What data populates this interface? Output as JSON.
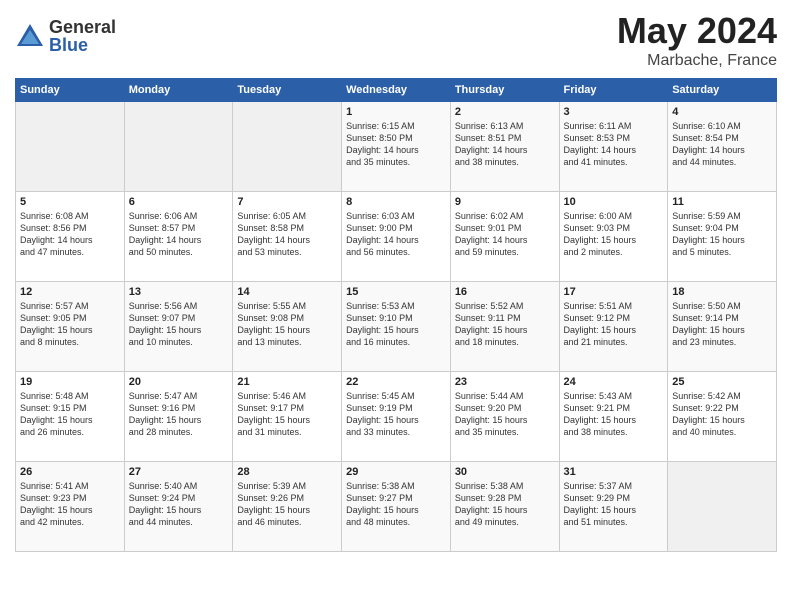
{
  "header": {
    "logo_general": "General",
    "logo_blue": "Blue",
    "month_title": "May 2024",
    "location": "Marbache, France"
  },
  "calendar": {
    "days_of_week": [
      "Sunday",
      "Monday",
      "Tuesday",
      "Wednesday",
      "Thursday",
      "Friday",
      "Saturday"
    ],
    "weeks": [
      [
        {
          "day": "",
          "content": ""
        },
        {
          "day": "",
          "content": ""
        },
        {
          "day": "",
          "content": ""
        },
        {
          "day": "1",
          "content": "Sunrise: 6:15 AM\nSunset: 8:50 PM\nDaylight: 14 hours\nand 35 minutes."
        },
        {
          "day": "2",
          "content": "Sunrise: 6:13 AM\nSunset: 8:51 PM\nDaylight: 14 hours\nand 38 minutes."
        },
        {
          "day": "3",
          "content": "Sunrise: 6:11 AM\nSunset: 8:53 PM\nDaylight: 14 hours\nand 41 minutes."
        },
        {
          "day": "4",
          "content": "Sunrise: 6:10 AM\nSunset: 8:54 PM\nDaylight: 14 hours\nand 44 minutes."
        }
      ],
      [
        {
          "day": "5",
          "content": "Sunrise: 6:08 AM\nSunset: 8:56 PM\nDaylight: 14 hours\nand 47 minutes."
        },
        {
          "day": "6",
          "content": "Sunrise: 6:06 AM\nSunset: 8:57 PM\nDaylight: 14 hours\nand 50 minutes."
        },
        {
          "day": "7",
          "content": "Sunrise: 6:05 AM\nSunset: 8:58 PM\nDaylight: 14 hours\nand 53 minutes."
        },
        {
          "day": "8",
          "content": "Sunrise: 6:03 AM\nSunset: 9:00 PM\nDaylight: 14 hours\nand 56 minutes."
        },
        {
          "day": "9",
          "content": "Sunrise: 6:02 AM\nSunset: 9:01 PM\nDaylight: 14 hours\nand 59 minutes."
        },
        {
          "day": "10",
          "content": "Sunrise: 6:00 AM\nSunset: 9:03 PM\nDaylight: 15 hours\nand 2 minutes."
        },
        {
          "day": "11",
          "content": "Sunrise: 5:59 AM\nSunset: 9:04 PM\nDaylight: 15 hours\nand 5 minutes."
        }
      ],
      [
        {
          "day": "12",
          "content": "Sunrise: 5:57 AM\nSunset: 9:05 PM\nDaylight: 15 hours\nand 8 minutes."
        },
        {
          "day": "13",
          "content": "Sunrise: 5:56 AM\nSunset: 9:07 PM\nDaylight: 15 hours\nand 10 minutes."
        },
        {
          "day": "14",
          "content": "Sunrise: 5:55 AM\nSunset: 9:08 PM\nDaylight: 15 hours\nand 13 minutes."
        },
        {
          "day": "15",
          "content": "Sunrise: 5:53 AM\nSunset: 9:10 PM\nDaylight: 15 hours\nand 16 minutes."
        },
        {
          "day": "16",
          "content": "Sunrise: 5:52 AM\nSunset: 9:11 PM\nDaylight: 15 hours\nand 18 minutes."
        },
        {
          "day": "17",
          "content": "Sunrise: 5:51 AM\nSunset: 9:12 PM\nDaylight: 15 hours\nand 21 minutes."
        },
        {
          "day": "18",
          "content": "Sunrise: 5:50 AM\nSunset: 9:14 PM\nDaylight: 15 hours\nand 23 minutes."
        }
      ],
      [
        {
          "day": "19",
          "content": "Sunrise: 5:48 AM\nSunset: 9:15 PM\nDaylight: 15 hours\nand 26 minutes."
        },
        {
          "day": "20",
          "content": "Sunrise: 5:47 AM\nSunset: 9:16 PM\nDaylight: 15 hours\nand 28 minutes."
        },
        {
          "day": "21",
          "content": "Sunrise: 5:46 AM\nSunset: 9:17 PM\nDaylight: 15 hours\nand 31 minutes."
        },
        {
          "day": "22",
          "content": "Sunrise: 5:45 AM\nSunset: 9:19 PM\nDaylight: 15 hours\nand 33 minutes."
        },
        {
          "day": "23",
          "content": "Sunrise: 5:44 AM\nSunset: 9:20 PM\nDaylight: 15 hours\nand 35 minutes."
        },
        {
          "day": "24",
          "content": "Sunrise: 5:43 AM\nSunset: 9:21 PM\nDaylight: 15 hours\nand 38 minutes."
        },
        {
          "day": "25",
          "content": "Sunrise: 5:42 AM\nSunset: 9:22 PM\nDaylight: 15 hours\nand 40 minutes."
        }
      ],
      [
        {
          "day": "26",
          "content": "Sunrise: 5:41 AM\nSunset: 9:23 PM\nDaylight: 15 hours\nand 42 minutes."
        },
        {
          "day": "27",
          "content": "Sunrise: 5:40 AM\nSunset: 9:24 PM\nDaylight: 15 hours\nand 44 minutes."
        },
        {
          "day": "28",
          "content": "Sunrise: 5:39 AM\nSunset: 9:26 PM\nDaylight: 15 hours\nand 46 minutes."
        },
        {
          "day": "29",
          "content": "Sunrise: 5:38 AM\nSunset: 9:27 PM\nDaylight: 15 hours\nand 48 minutes."
        },
        {
          "day": "30",
          "content": "Sunrise: 5:38 AM\nSunset: 9:28 PM\nDaylight: 15 hours\nand 49 minutes."
        },
        {
          "day": "31",
          "content": "Sunrise: 5:37 AM\nSunset: 9:29 PM\nDaylight: 15 hours\nand 51 minutes."
        },
        {
          "day": "",
          "content": ""
        }
      ]
    ]
  }
}
